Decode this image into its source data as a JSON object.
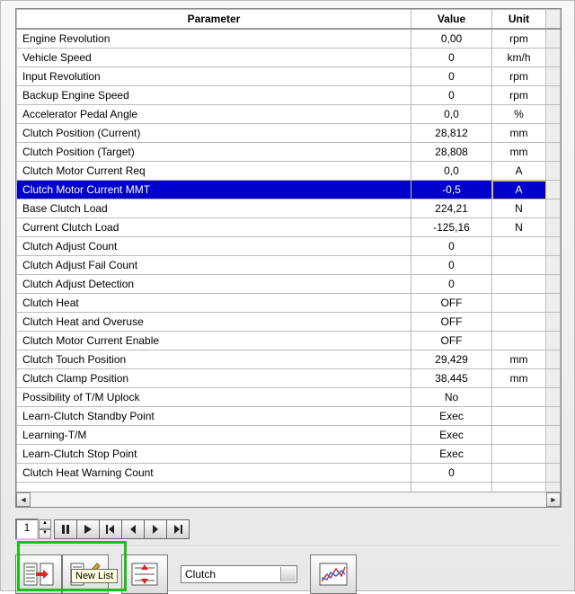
{
  "headers": {
    "param": "Parameter",
    "value": "Value",
    "unit": "Unit"
  },
  "rows": [
    {
      "p": "Engine Revolution",
      "v": "0,00",
      "u": "rpm"
    },
    {
      "p": "Vehicle Speed",
      "v": "0",
      "u": "km/h"
    },
    {
      "p": "Input Revolution",
      "v": "0",
      "u": "rpm"
    },
    {
      "p": "Backup Engine Speed",
      "v": "0",
      "u": "rpm"
    },
    {
      "p": "Accelerator Pedal Angle",
      "v": "0,0",
      "u": "%"
    },
    {
      "p": "Clutch Position (Current)",
      "v": "28,812",
      "u": "mm"
    },
    {
      "p": "Clutch Position (Target)",
      "v": "28,808",
      "u": "mm"
    },
    {
      "p": "Clutch Motor Current Req",
      "v": "0,0",
      "u": "A"
    },
    {
      "p": "Clutch Motor Current MMT",
      "v": "-0,5",
      "u": "A",
      "selected": true
    },
    {
      "p": "Base Clutch Load",
      "v": "224,21",
      "u": "N"
    },
    {
      "p": "Current Clutch Load",
      "v": "-125,16",
      "u": "N"
    },
    {
      "p": "Clutch Adjust Count",
      "v": "0",
      "u": ""
    },
    {
      "p": "Clutch Adjust Fail Count",
      "v": "0",
      "u": ""
    },
    {
      "p": "Clutch Adjust Detection",
      "v": "0",
      "u": ""
    },
    {
      "p": "Clutch Heat",
      "v": "OFF",
      "u": ""
    },
    {
      "p": "Clutch Heat and Overuse",
      "v": "OFF",
      "u": ""
    },
    {
      "p": "Clutch Motor Current Enable",
      "v": "OFF",
      "u": ""
    },
    {
      "p": "Clutch Touch Position",
      "v": "29,429",
      "u": "mm"
    },
    {
      "p": "Clutch Clamp Position",
      "v": "38,445",
      "u": "mm"
    },
    {
      "p": "Possibility of T/M Uplock",
      "v": "No",
      "u": ""
    },
    {
      "p": "Learn-Clutch Standby Point",
      "v": "Exec",
      "u": ""
    },
    {
      "p": "Learning-T/M",
      "v": "Exec",
      "u": ""
    },
    {
      "p": "Learn-Clutch Stop Point",
      "v": "Exec",
      "u": ""
    },
    {
      "p": "Clutch Heat Warning Count",
      "v": "0",
      "u": ""
    }
  ],
  "emptyRows": 3,
  "spinner": {
    "value": "1"
  },
  "combo": {
    "selected": "Clutch"
  },
  "tooltip": {
    "text": "New List"
  }
}
